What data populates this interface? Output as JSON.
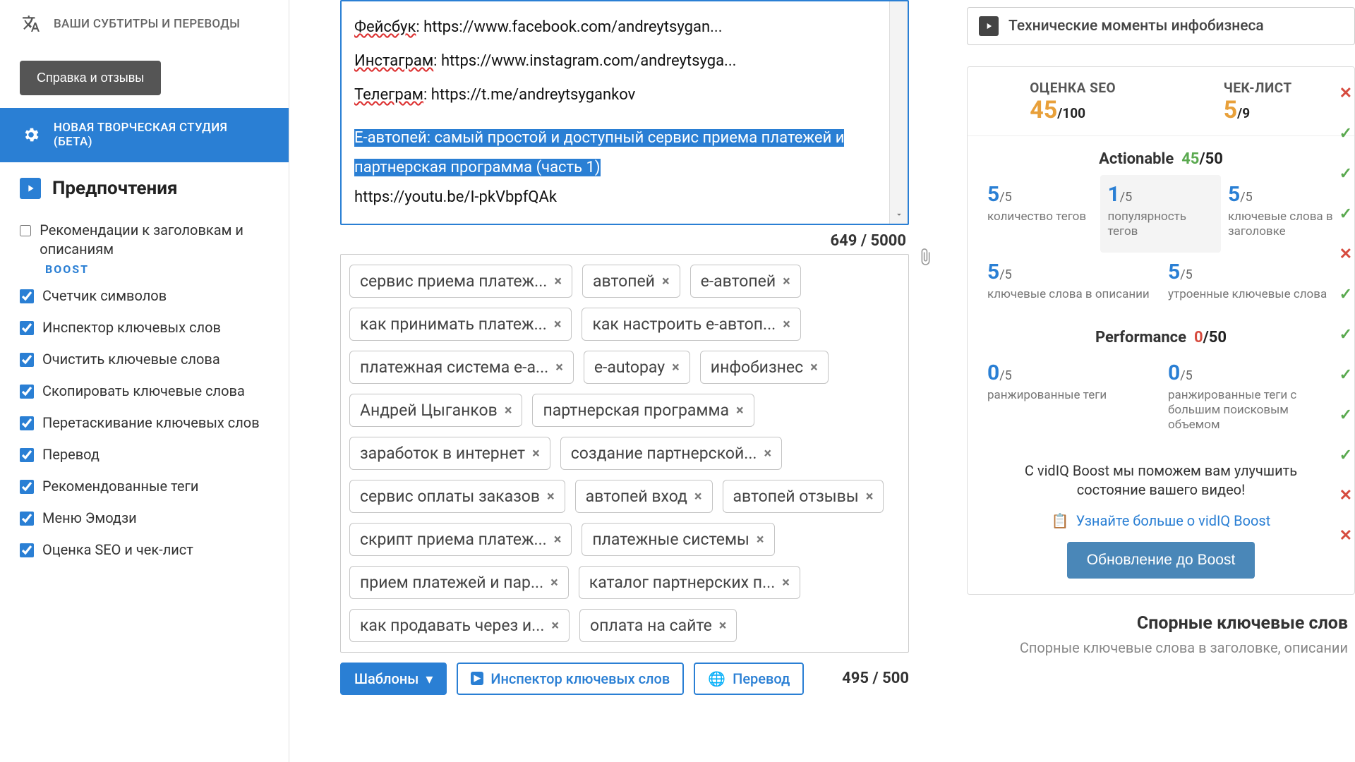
{
  "sidebar": {
    "subtitles": "ВАШИ СУБТИТРЫ И ПЕРЕВОДЫ",
    "help_btn": "Справка и отзывы",
    "studio": "НОВАЯ ТВОРЧЕСКАЯ СТУДИЯ (БЕТА)",
    "prefs_title": "Предпочтения",
    "checks": [
      {
        "label": "Рекомендации к заголовкам и описаниям",
        "checked": false
      },
      {
        "label": "Счетчик символов",
        "checked": true
      },
      {
        "label": "Инспектор ключевых слов",
        "checked": true
      },
      {
        "label": "Очистить ключевые слова",
        "checked": true
      },
      {
        "label": "Скопировать ключевые слова",
        "checked": true
      },
      {
        "label": "Перетаскивание ключевых слов",
        "checked": true
      },
      {
        "label": "Перевод",
        "checked": true
      },
      {
        "label": "Рекомендованные теги",
        "checked": true
      },
      {
        "label": "Меню Эмодзи",
        "checked": true
      },
      {
        "label": "Оценка SEO и чек-лист",
        "checked": true
      }
    ],
    "boost_lbl": "BOOST"
  },
  "description": {
    "lines": [
      {
        "prefix": "Фейсбук",
        "rest": ": https://www.facebook.com/andreytsygan..."
      },
      {
        "prefix": "Инстаграм",
        "rest": ": https://www.instagram.com/andreytsyga..."
      },
      {
        "prefix": "Телеграм",
        "rest": ": https://t.me/andreytsygankov"
      }
    ],
    "selected": "Е-автопей: самый простой и доступный сервис приема платежей и партнерская программа (часть 1)",
    "last": "https://youtu.be/I-pkVbpfQAk",
    "count": "649 / 5000"
  },
  "tags": [
    "сервис приема платеж...",
    "автопей",
    "е-автопей",
    "как принимать платеж...",
    "как настроить е-автоп...",
    "платежная система е-а...",
    "e-autopay",
    "инфобизнес",
    "Андрей Цыганков",
    "партнерская программа",
    "заработок в интернет",
    "создание партнерской...",
    "сервис оплаты заказов",
    "автопей вход",
    "автопей отзывы",
    "скрипт приема платеж...",
    "платежные системы",
    "прием платежей и пар...",
    "каталог партнерских п...",
    "как продавать через и...",
    "оплата на сайте"
  ],
  "tag_count": "495 / 500",
  "toolbar": {
    "templates": "Шаблоны",
    "inspector": "Инспектор ключевых слов",
    "translate": "Перевод"
  },
  "right": {
    "tech": "Технические моменты инфобизнеса",
    "seo_label": "ОЦЕНКА SEO",
    "seo_val": "45",
    "seo_den": "/100",
    "check_label": "ЧЕК-ЛИСТ",
    "check_val": "5",
    "check_den": "/9",
    "actionable_label": "Actionable",
    "actionable_val": "45",
    "actionable_den": "/50",
    "performance_label": "Performance",
    "performance_val": "0",
    "performance_den": "/50",
    "a_scores": [
      {
        "v": "5",
        "d": "/5",
        "l": "количество тегов",
        "hl": false
      },
      {
        "v": "1",
        "d": "/5",
        "l": "популярность тегов",
        "hl": true
      },
      {
        "v": "5",
        "d": "/5",
        "l": "ключевые слова в заголовке",
        "hl": false
      },
      {
        "v": "5",
        "d": "/5",
        "l": "ключевые слова в описании",
        "hl": false
      },
      {
        "v": "5",
        "d": "/5",
        "l": "утроенные ключевые слова",
        "hl": false
      }
    ],
    "p_scores": [
      {
        "v": "0",
        "d": "/5",
        "l": "ранжированные теги"
      },
      {
        "v": "0",
        "d": "/5",
        "l": "ранжированные теги с большим поисковым объемом"
      }
    ],
    "boost_msg": "С vidIQ Boost мы поможем вам улучшить состояние вашего видео!",
    "boost_link": "Узнайте больше о vidIQ Boost",
    "boost_btn": "Обновление до Boost",
    "contro_h": "Спорные ключевые слов",
    "contro_s": "Спорные ключевые слова в заголовке, описании"
  },
  "marks": [
    "r",
    "g",
    "g",
    "g",
    "r",
    "g",
    "g",
    "g",
    "g",
    "g",
    "r",
    "r"
  ]
}
